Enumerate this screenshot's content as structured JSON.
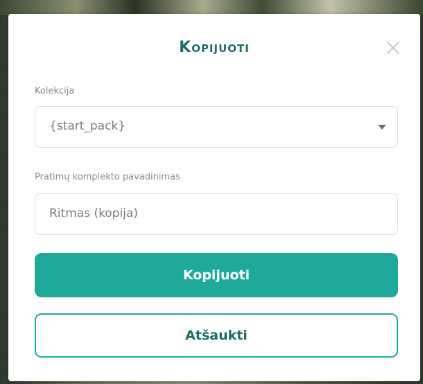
{
  "dialog": {
    "title": "Kopijuoti",
    "close_icon": "close-icon",
    "collection": {
      "label": "Kolekcija",
      "selected_value": "{start_pack}"
    },
    "set_name": {
      "label": "Pratimų komplekto pavadinimas",
      "value": "Ritmas (kopija)"
    },
    "confirm_label": "Kopijuoti",
    "cancel_label": "Atšaukti"
  },
  "colors": {
    "title": "#1f6e6a",
    "primary": "#1fa99a"
  }
}
